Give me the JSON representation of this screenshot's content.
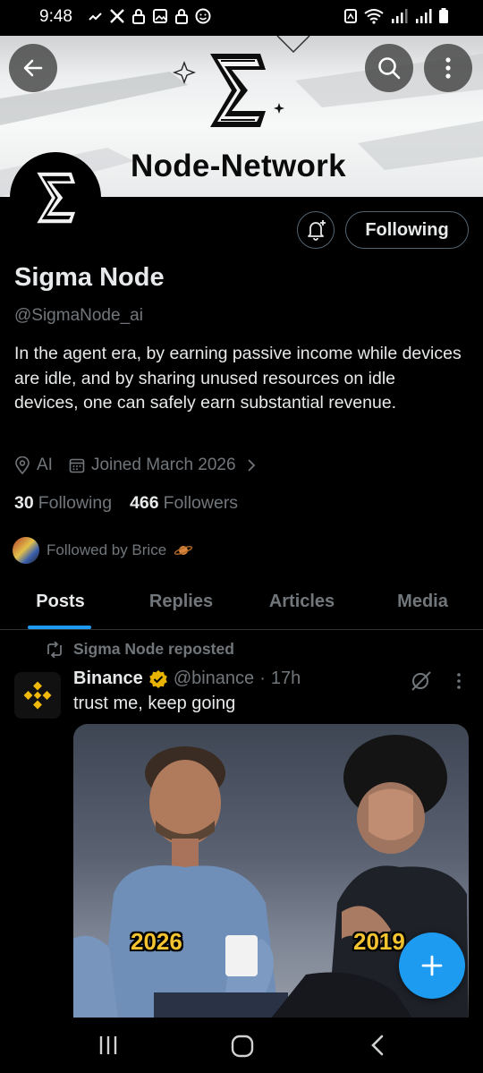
{
  "status_bar": {
    "time": "9:48"
  },
  "banner": {
    "title": "Node-Network"
  },
  "header": {
    "back_label": "Back",
    "search_label": "Search",
    "more_label": "More"
  },
  "profile": {
    "name": "Sigma Node",
    "handle": "@SigmaNode_ai",
    "bio": "In the agent era, by earning passive income while devices are idle, and by sharing unused resources on idle devices, one can safely earn substantial revenue.",
    "location": "AI",
    "joined": "Joined March 2026",
    "following_count": "30",
    "following_label": "Following",
    "followers_count": "466",
    "followers_label": "Followers",
    "followed_by": "Followed by Brice",
    "follow_button": "Following"
  },
  "tabs": [
    {
      "label": "Posts",
      "active": true
    },
    {
      "label": "Replies",
      "active": false
    },
    {
      "label": "Articles",
      "active": false
    },
    {
      "label": "Media",
      "active": false
    }
  ],
  "post": {
    "repost_label": "Sigma Node reposted",
    "author_name": "Binance",
    "author_handle": "@binance",
    "separator": "·",
    "time": "17h",
    "text": "trust me, keep going",
    "image_captions": {
      "left": "2026",
      "right": "2019"
    }
  },
  "colors": {
    "accent": "#1d9bf0",
    "muted": "#71767b",
    "text": "#e7e9ea",
    "binance": "#f0b90b",
    "verified": "#e8b300"
  },
  "icons": [
    "back-arrow-icon",
    "search-icon",
    "more-vertical-icon",
    "bell-plus-icon",
    "location-icon",
    "calendar-icon",
    "chevron-right-icon",
    "repost-icon",
    "verified-badge-icon",
    "grok-icon",
    "plus-icon",
    "recent-apps-icon",
    "home-icon",
    "nav-back-icon"
  ]
}
